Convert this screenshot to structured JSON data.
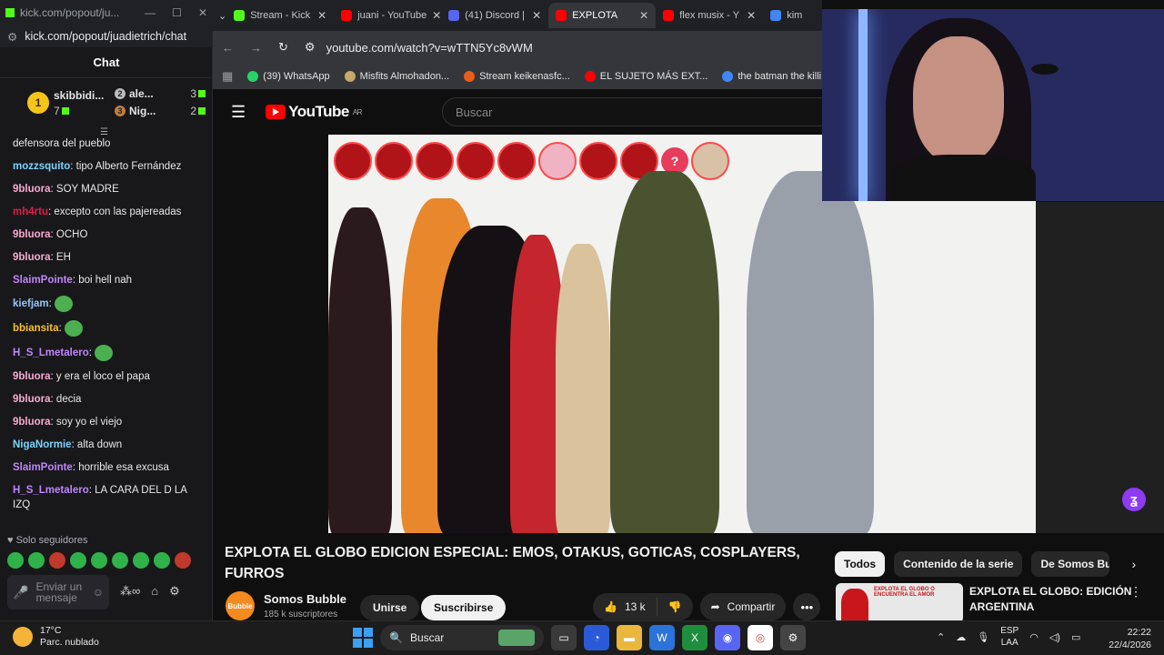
{
  "chat_window": {
    "url_short": "kick.com/popout/ju...",
    "url": "kick.com/popout/juadietrich/chat",
    "header": "Chat",
    "leaderboard": {
      "first": {
        "rank": "1",
        "name": "skibbidi...",
        "count": "7"
      },
      "second": {
        "rank": "2",
        "name": "ale...",
        "count": "3"
      },
      "third": {
        "rank": "3",
        "name": "Nig...",
        "count": "2"
      }
    },
    "messages": [
      {
        "user": "",
        "text": "defensora del pueblo",
        "color": "#e8e8e8"
      },
      {
        "user": "mozzsquito",
        "text": ": tipo Alberto Fernández",
        "color": "#7dd3fc"
      },
      {
        "user": "9bluora",
        "text": ": SOY MADRE",
        "color": "#f9a8d4"
      },
      {
        "user": "mh4rtu",
        "text": ": excepto con las pajereadas",
        "color": "#e11d48"
      },
      {
        "user": "9bluora",
        "text": ": OCHO",
        "color": "#f9a8d4"
      },
      {
        "user": "9bluora",
        "text": ": EH",
        "color": "#f9a8d4"
      },
      {
        "user": "SlaimPointe",
        "text": ": boi hell nah",
        "color": "#c084fc"
      },
      {
        "user": "kiefjam",
        "text": ":",
        "color": "#93c5fd"
      },
      {
        "user": "bbiansita",
        "text": ":",
        "color": "#fbbf24"
      },
      {
        "user": "H_S_Lmetalero",
        "text": ":",
        "color": "#c084fc"
      },
      {
        "user": "9bluora",
        "text": ": y era el loco el papa",
        "color": "#f9a8d4"
      },
      {
        "user": "9bluora",
        "text": ": decia",
        "color": "#f9a8d4"
      },
      {
        "user": "9bluora",
        "text": ": soy yo el viejo",
        "color": "#f9a8d4"
      },
      {
        "user": "NigaNormie",
        "text": ": alta down",
        "color": "#7dd3fc"
      },
      {
        "user": "SlaimPointe",
        "text": ": horrible esa excusa",
        "color": "#c084fc"
      },
      {
        "user": "H_S_Lmetalero",
        "text": ": LA CARA DEL D LA IZQ",
        "color": "#c084fc"
      }
    ],
    "followers_only": "Solo seguidores",
    "input_placeholder": "Enviar un mensaje"
  },
  "browser": {
    "tabs": [
      {
        "title": "Stream - Kick",
        "color": "#53fc18",
        "active": false
      },
      {
        "title": "juani - YouTube",
        "color": "#ff0000",
        "active": false
      },
      {
        "title": "(41) Discord |",
        "color": "#5865f2",
        "active": false
      },
      {
        "title": "EXPLOTA",
        "color": "#ff0000",
        "active": true
      },
      {
        "title": "flex musix - Y",
        "color": "#ff0000",
        "active": false
      },
      {
        "title": "kim",
        "color": "#4285f4",
        "active": false
      }
    ],
    "url": "youtube.com/watch?v=wTTN5Yc8vWM",
    "bookmarks": [
      {
        "label": "(39) WhatsApp",
        "color": "#25d366"
      },
      {
        "label": "Misfits Almohadon...",
        "color": "#c8a86b"
      },
      {
        "label": "Stream keikenasfc...",
        "color": "#e85d1a"
      },
      {
        "label": "EL SUJETO MÁS EXT...",
        "color": "#ff0000"
      },
      {
        "label": "the batman the killi...",
        "color": "#4285f4"
      }
    ]
  },
  "youtube": {
    "logo_text": "YouTube",
    "region": "AR",
    "search_placeholder": "Buscar",
    "video_title": "EXPLOTA EL GLOBO EDICION ESPECIAL: EMOS, OTAKUS, GOTICAS, COSPLAYERS, FURROS",
    "channel": {
      "name": "Somos Bubble",
      "subscribers": "185 k suscriptores",
      "avatar_text": "Bubble"
    },
    "join_label": "Unirse",
    "subscribe_label": "Suscribirse",
    "likes": "13 k",
    "share_label": "Compartir",
    "chips": [
      "Todos",
      "Contenido de la serie",
      "De Somos Bubble"
    ],
    "recommendation": {
      "title": "EXPLOTA EL GLOBO: EDICIÓN ARGENTINA",
      "thumb_text": "EXPLOTA EL GLOBO O ENCUENTRA EL AMOR"
    }
  },
  "taskbar": {
    "temperature": "17°C",
    "weather": "Parc. nublado",
    "search": "Buscar",
    "lang_top": "ESP",
    "lang_bottom": "LAA",
    "time": "22:22",
    "date": "22/4/2026"
  }
}
